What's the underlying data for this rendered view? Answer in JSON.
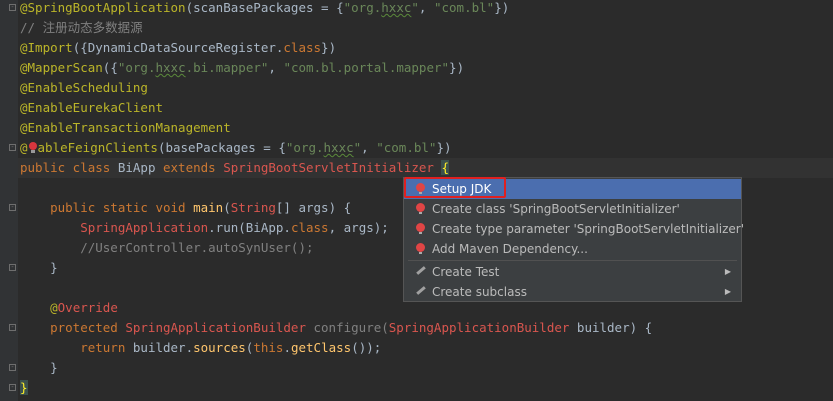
{
  "editor": {
    "lines": [
      {
        "parts": [
          "@",
          "SpringBootApplication",
          "(scanBasePackages = {",
          "\"org.",
          "hxxc",
          "\"",
          ", ",
          "\"com.bl\"",
          "})"
        ]
      },
      {
        "comment": "// 注册动态多数据源"
      },
      {
        "parts": [
          "@",
          "Import",
          "({DynamicDataSourceRegister.",
          "class",
          "})"
        ]
      },
      {
        "parts": [
          "@",
          "MapperScan",
          "({",
          "\"org.",
          "hxxc",
          ".bi.mapper\"",
          ", ",
          "\"com.bl.portal.mapper\"",
          "})"
        ]
      },
      {
        "parts": [
          "@",
          "EnableScheduling"
        ]
      },
      {
        "parts": [
          "@",
          "EnableEurekaClient"
        ]
      },
      {
        "parts": [
          "@",
          "EnableTransactionManagement"
        ]
      },
      {
        "parts": [
          "@",
          "ableFeignClients",
          "(basePackages = {",
          "\"org.",
          "hxxc",
          "\"",
          ", ",
          "\"com.bl\"",
          "})"
        ]
      },
      {
        "parts": [
          "public class ",
          "BiApp ",
          "extends ",
          "SpringBootServletInitializer",
          " ",
          "{"
        ]
      },
      {
        "parts": [
          "    public static void ",
          "main",
          "(",
          "String",
          "[] args) {"
        ]
      },
      {
        "parts": [
          "        ",
          "SpringApplication",
          ".run(BiApp.",
          "class",
          ", args);"
        ]
      },
      {
        "comment": "        //UserController.autoSynUser();"
      },
      {
        "parts": [
          "    }"
        ]
      },
      {
        "parts": [
          "    @",
          "Override"
        ]
      },
      {
        "parts": [
          "    protected ",
          "SpringApplicationBuilder",
          " configure(",
          "SpringApplicationBuilder",
          " builder) {"
        ]
      },
      {
        "parts": [
          "        return ",
          "builder.",
          "sources",
          "(",
          "this",
          ".",
          "getClass",
          "());"
        ]
      },
      {
        "parts": [
          "    }"
        ]
      },
      {
        "parts": [
          "}"
        ]
      }
    ]
  },
  "popup": {
    "items": [
      {
        "label": "Setup JDK",
        "icon": "error-bulb-icon",
        "selected": true
      },
      {
        "label": "Create class 'SpringBootServletInitializer'",
        "icon": "error-bulb-icon"
      },
      {
        "label": "Create type parameter 'SpringBootServletInitializer'",
        "icon": "error-bulb-icon"
      },
      {
        "label": "Add Maven Dependency...",
        "icon": "error-bulb-icon"
      },
      {
        "label": "Create Test",
        "icon": "pencil-icon",
        "submenu": "▶"
      },
      {
        "label": "Create subclass",
        "icon": "pencil-icon",
        "submenu": "▶"
      }
    ]
  },
  "colors": {
    "background": "#2b2b2b",
    "annotation": "#bbb529",
    "keyword": "#cc7832",
    "string": "#6a8759",
    "comment": "#808080",
    "selection": "#4b6eaf",
    "highlight_box": "#e02020"
  }
}
